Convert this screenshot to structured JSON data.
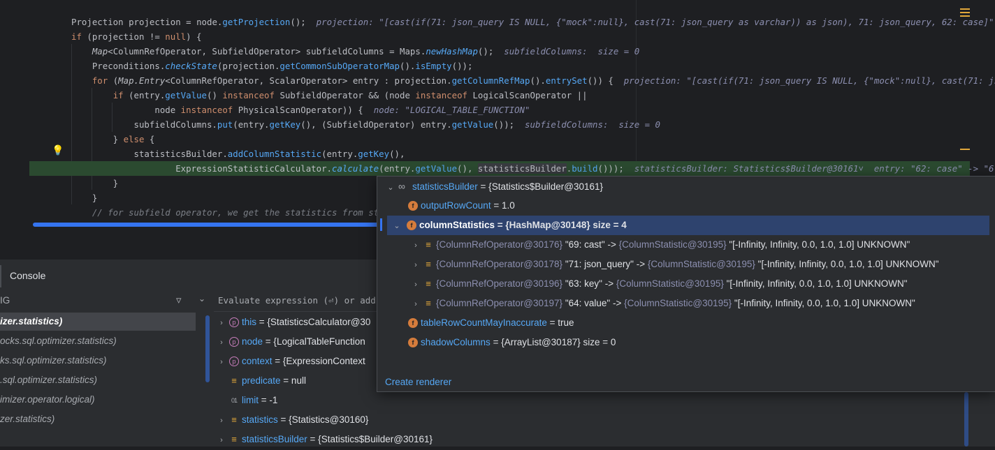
{
  "editor": {
    "lines": [
      {
        "html": "<span class=\"ty\">Projection</span> <span class=\"pr\">projection</span> = node.<span class=\"fn\">getProjection</span>();  <span class=\"hint\">projection: \"[cast(if(71: json_query IS NULL, {\"mock\":null}, cast(71: json_query as varchar)) as json), 71: json_query, 62: case]\"</span>"
      },
      {
        "html": "<span class=\"kw\">if</span> (projection != <span class=\"kw\">null</span>) {"
      },
      {
        "html": "    <span class=\"it\">Map</span>&lt;ColumnRefOperator, SubfieldOperator&gt; <span class=\"pr\">subfieldColumns</span> = Maps.<span class=\"st\">newHashMap</span>();  <span class=\"hint\">subfieldColumns:  size = 0</span>"
      },
      {
        "html": "    Preconditions.<span class=\"st\">checkState</span>(projection.<span class=\"fn\">getCommonSubOperatorMap</span>().<span class=\"fn\">isEmpty</span>());"
      },
      {
        "html": "    <span class=\"kw\">for</span> (<span class=\"it\">Map.Entry</span>&lt;ColumnRefOperator, ScalarOperator&gt; entry : projection.<span class=\"fn\">getColumnRefMap</span>().<span class=\"fn\">entrySet</span>()) {  <span class=\"hint\">projection: \"[cast(if(71: json_query IS NULL, {\"mock\":null}, cast(71: js</span>"
      },
      {
        "html": "        <span class=\"kw\">if</span> (entry.<span class=\"fn\">getValue</span>() <span class=\"kw\">instanceof</span> SubfieldOperator &amp;&amp; (node <span class=\"kw\">instanceof</span> LogicalScanOperator ||"
      },
      {
        "html": "                node <span class=\"kw\">instanceof</span> PhysicalScanOperator)) {  <span class=\"hint\">node: \"LOGICAL_TABLE_FUNCTION\"</span>"
      },
      {
        "html": "            subfieldColumns.<span class=\"fn\">put</span>(entry.<span class=\"fn\">getKey</span>(), (SubfieldOperator) entry.<span class=\"fn\">getValue</span>());  <span class=\"hint\">subfieldColumns:  size = 0</span>"
      },
      {
        "html": "        } <span class=\"kw\">else</span> {"
      },
      {
        "html": "            statisticsBuilder.<span class=\"fn\">addColumnStatistic</span>(entry.<span class=\"fn\">getKey</span>(),"
      },
      {
        "html": "                    ExpressionStatisticCalculator.<span class=\"st\">calculate</span>(entry.<span class=\"fn\">getValue</span>(), <span class=\"hlbox\">statisticsBuilder</span>.<span class=\"fn\">build</span>()));  <span class=\"hint\">statisticsBuilder: Statistics$Builder@30161&#709;  entry: \"62: case\" -&gt; \"6</span>"
      },
      {
        "html": "        }"
      },
      {
        "html": "    }"
      },
      {
        "html": "    <span class=\"cm\">// for subfield operator, we get the statistics from sta</span>"
      }
    ]
  },
  "console_tab": "Console",
  "frames_label": "IG",
  "frames": [
    "izer.statistics)",
    "ocks.sql.optimizer.statistics)",
    "ks.sql.optimizer.statistics)",
    ".sql.optimizer.statistics)",
    "imizer.operator.logical)",
    "zer.statistics)"
  ],
  "eval_placeholder": "Evaluate expression (⏎) or add a",
  "variables": [
    {
      "arrow": "›",
      "icon": "p",
      "name": "this",
      "value": " = {StatisticsCalculator@30"
    },
    {
      "arrow": "›",
      "icon": "p",
      "name": "node",
      "value": " = {LogicalTableFunction"
    },
    {
      "arrow": "›",
      "icon": "p",
      "name": "context",
      "value": " = {ExpressionContext"
    },
    {
      "arrow": "",
      "icon": "eq",
      "name": "predicate",
      "value": " = null"
    },
    {
      "arrow": "",
      "icon": "01",
      "name": "limit",
      "value": " = -1"
    },
    {
      "arrow": "›",
      "icon": "eq",
      "name": "statistics",
      "value": " = {Statistics@30160}"
    },
    {
      "arrow": "›",
      "icon": "eq",
      "name": "statisticsBuilder",
      "value": " = {Statistics$Builder@30161}"
    }
  ],
  "popup": {
    "root_name": "statisticsBuilder",
    "root_value": " = {Statistics$Builder@30161}",
    "fields": [
      {
        "name": "outputRowCount",
        "value": " = 1.0"
      },
      {
        "name": "columnStatistics",
        "value": " = {HashMap@30148}  size = 4"
      }
    ],
    "entries": [
      {
        "key": "{ColumnRefOperator@30176} ",
        "label": "\"69: cast\"",
        "arrow": " -> ",
        "val": "{ColumnStatistic@30195} ",
        "text": "\"[-Infinity, Infinity, 0.0, 1.0, 1.0] UNKNOWN\""
      },
      {
        "key": "{ColumnRefOperator@30178} ",
        "label": "\"71: json_query\"",
        "arrow": " -> ",
        "val": "{ColumnStatistic@30195} ",
        "text": "\"[-Infinity, Infinity, 0.0, 1.0, 1.0] UNKNOWN\""
      },
      {
        "key": "{ColumnRefOperator@30196} ",
        "label": "\"63: key\"",
        "arrow": " -> ",
        "val": "{ColumnStatistic@30195} ",
        "text": "\"[-Infinity, Infinity, 0.0, 1.0, 1.0] UNKNOWN\""
      },
      {
        "key": "{ColumnRefOperator@30197} ",
        "label": "\"64: value\"",
        "arrow": " -> ",
        "val": "{ColumnStatistic@30195} ",
        "text": "\"[-Infinity, Infinity, 0.0, 1.0, 1.0] UNKNOWN\""
      }
    ],
    "trailing": [
      {
        "name": "tableRowCountMayInaccurate",
        "value": " = true"
      },
      {
        "name": "shadowColumns",
        "value": " = {ArrayList@30187}  size = 0"
      }
    ],
    "create_renderer": "Create renderer"
  },
  "colors": {
    "accent": "#3574f0",
    "exec_line": "#2b4a30",
    "selection": "#2e436e"
  }
}
